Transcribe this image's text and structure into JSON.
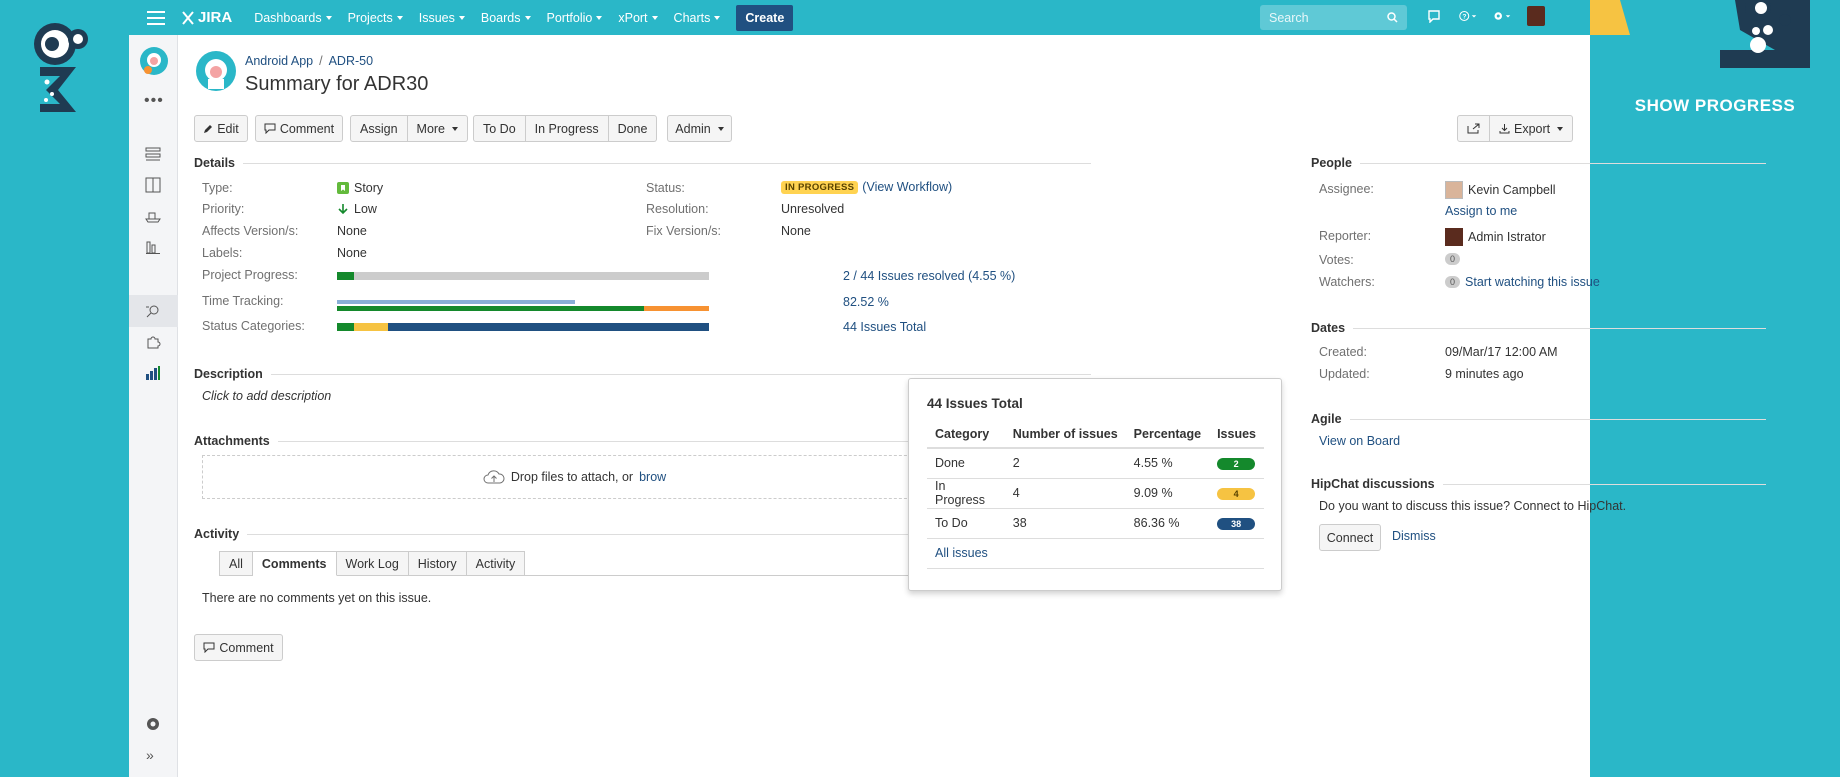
{
  "promo": {
    "show_progress": "SHOW PROGRESS"
  },
  "topbar": {
    "logo": "JIRA",
    "nav": [
      "Dashboards",
      "Projects",
      "Issues",
      "Boards",
      "Portfolio",
      "xPort",
      "Charts"
    ],
    "create": "Create",
    "search_placeholder": "Search"
  },
  "header": {
    "project": "Android App",
    "issue_key": "ADR-50",
    "title": "Summary for ADR30"
  },
  "toolbar": {
    "edit": "Edit",
    "comment": "Comment",
    "assign": "Assign",
    "more": "More",
    "todo": "To Do",
    "in_progress": "In Progress",
    "done": "Done",
    "admin": "Admin",
    "export": "Export"
  },
  "details": {
    "heading": "Details",
    "type_label": "Type:",
    "type_value": "Story",
    "priority_label": "Priority:",
    "priority_value": "Low",
    "affects_label": "Affects Version/s:",
    "affects_value": "None",
    "labels_label": "Labels:",
    "labels_value": "None",
    "status_label": "Status:",
    "status_value": "IN PROGRESS",
    "workflow_link": "(View Workflow)",
    "resolution_label": "Resolution:",
    "resolution_value": "Unresolved",
    "fix_label": "Fix Version/s:",
    "fix_value": "None",
    "project_progress_label": "Project Progress:",
    "project_progress_text": "2 / 44 Issues resolved (4.55 %)",
    "project_progress_fraction": 0.0455,
    "time_tracking_label": "Time Tracking:",
    "time_tracking_text": "82.52 %",
    "time_tracking_fraction": 0.8252,
    "status_categories_label": "Status Categories:",
    "status_categories_text": "44 Issues Total"
  },
  "description": {
    "heading": "Description",
    "placeholder": "Click to add description"
  },
  "attachments": {
    "heading": "Attachments",
    "drop_text": "Drop files to attach, or",
    "browse": "brow"
  },
  "activity": {
    "heading": "Activity",
    "tabs": [
      "All",
      "Comments",
      "Work Log",
      "History",
      "Activity"
    ],
    "active_tab": "Comments",
    "empty": "There are no comments yet on this issue.",
    "comment_button": "Comment"
  },
  "popup": {
    "title": "44 Issues Total",
    "headers": [
      "Category",
      "Number of issues",
      "Percentage",
      "Issues"
    ],
    "rows": [
      {
        "category": "Done",
        "count": "2",
        "percent": "4.55 %",
        "badge": "2",
        "color": "#14892c"
      },
      {
        "category": "In Progress",
        "count": "4",
        "percent": "9.09 %",
        "badge": "4",
        "color": "#f6c342"
      },
      {
        "category": "To Do",
        "count": "38",
        "percent": "86.36 %",
        "badge": "38",
        "color": "#205081"
      }
    ],
    "all_issues": "All issues"
  },
  "people": {
    "heading": "People",
    "assignee_label": "Assignee:",
    "assignee": "Kevin Campbell",
    "assign_to_me": "Assign to me",
    "reporter_label": "Reporter:",
    "reporter": "Admin Istrator",
    "votes_label": "Votes:",
    "votes": "0",
    "watchers_label": "Watchers:",
    "watchers": "0",
    "watch_link": "Start watching this issue"
  },
  "dates": {
    "heading": "Dates",
    "created_label": "Created:",
    "created": "09/Mar/17 12:00 AM",
    "updated_label": "Updated:",
    "updated": "9 minutes ago"
  },
  "agile": {
    "heading": "Agile",
    "link": "View on Board"
  },
  "hipchat": {
    "heading": "HipChat discussions",
    "text": "Do you want to discuss this issue? Connect to HipChat.",
    "connect": "Connect",
    "dismiss": "Dismiss"
  },
  "colors": {
    "teal": "#2ab7c8",
    "navy": "#205081",
    "green": "#14892c",
    "yellow": "#f6c342",
    "orange": "#f79232",
    "grey": "#ccc"
  }
}
